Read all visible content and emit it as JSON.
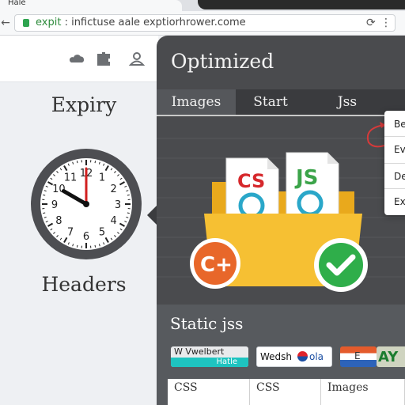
{
  "browser": {
    "tab_title": "Hale",
    "url_highlight": "expit",
    "url_rest": " : infictuse aale exptiorhrower.come",
    "icons": [
      "back-arrow-icon",
      "lock-icon",
      "refresh-icon",
      "bookmark-icon",
      "menu-icon"
    ]
  },
  "left_panel": {
    "toolbar_icons": [
      "cloud-icon",
      "extension-icon",
      "user-icon"
    ],
    "title": "Expiry",
    "caption": "Headers",
    "clock": {
      "hour": 10,
      "minute": 0,
      "numerals": [
        "12",
        "1",
        "2",
        "3",
        "4",
        "5",
        "6",
        "7",
        "8",
        "9",
        "10",
        "11"
      ]
    }
  },
  "main_panel": {
    "title": "Optimized",
    "tabs": [
      {
        "label": "Images",
        "active": true
      },
      {
        "label": "Start",
        "active": false
      },
      {
        "label": "Jss",
        "active": false
      }
    ],
    "folder": {
      "files": [
        "CS",
        "JS"
      ],
      "badge_left": "C+",
      "badge_right": "check-icon"
    },
    "section_title": "Static jss",
    "badges": [
      {
        "top": "W Vwelbert",
        "bottom": "Hatle"
      },
      {
        "text_a": "Wedsh",
        "text_b": "ola"
      },
      {
        "text": "E"
      },
      {
        "text": "AY"
      }
    ],
    "table_row": [
      "CSS",
      "CSS",
      "Images"
    ]
  },
  "context_menu": {
    "items": [
      "Be",
      "Ev",
      "De",
      "Ex"
    ]
  },
  "colors": {
    "accent_orange": "#e8672a",
    "folder_yellow": "#f6c033",
    "check_green": "#2fae4a",
    "dark_panel": "#4a4b4e"
  }
}
